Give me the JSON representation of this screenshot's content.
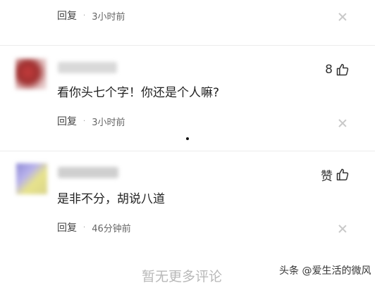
{
  "comments": [
    {
      "reply_label": "回复",
      "separator": "·",
      "time": "3小时前"
    },
    {
      "reply_label": "回复",
      "separator": "·",
      "time": "3小时前",
      "likes": "8",
      "text": "看你头七个字！你还是个人嘛?"
    },
    {
      "reply_label": "回复",
      "separator": "·",
      "time": "46分钟前",
      "likes": "赞",
      "text": "是非不分，胡说八道"
    }
  ],
  "footer": {
    "no_more": "暂无更多评论"
  },
  "watermark": "头条 @爱生活的微风",
  "icons": {
    "like": "thumbs-up-icon",
    "close": "close-icon"
  },
  "colors": {
    "muted": "#999999",
    "divider": "#ececec"
  }
}
